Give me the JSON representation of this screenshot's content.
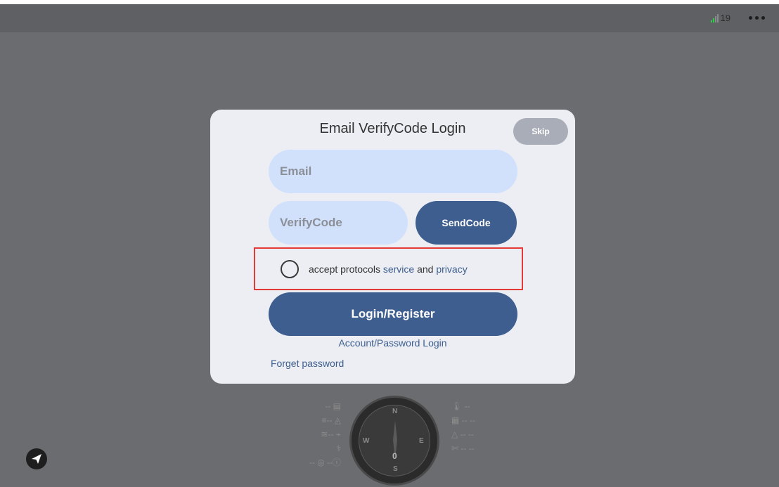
{
  "status_bar": {
    "signal_text": "19"
  },
  "modal": {
    "title": "Email VerifyCode Login",
    "skip_label": "Skip",
    "email_placeholder": "Email",
    "code_placeholder": "VerifyCode",
    "send_code_label": "SendCode",
    "agreement": {
      "prefix": "accept protocols ",
      "service_link": "service",
      "middle": " and ",
      "privacy_link": "privacy"
    },
    "login_label": "Login/Register",
    "account_login_label": "Account/Password Login",
    "forget_label": "Forget password"
  },
  "compass": {
    "n": "N",
    "s": "S",
    "e": "E",
    "w": "W",
    "value": "0"
  },
  "colors": {
    "primary": "#3e5e8f",
    "field_bg": "#d2e1fb",
    "highlight": "#e53935"
  },
  "icons": [
    "signal-icon",
    "more-icon",
    "telegram-send-icon",
    "compass-icon"
  ]
}
